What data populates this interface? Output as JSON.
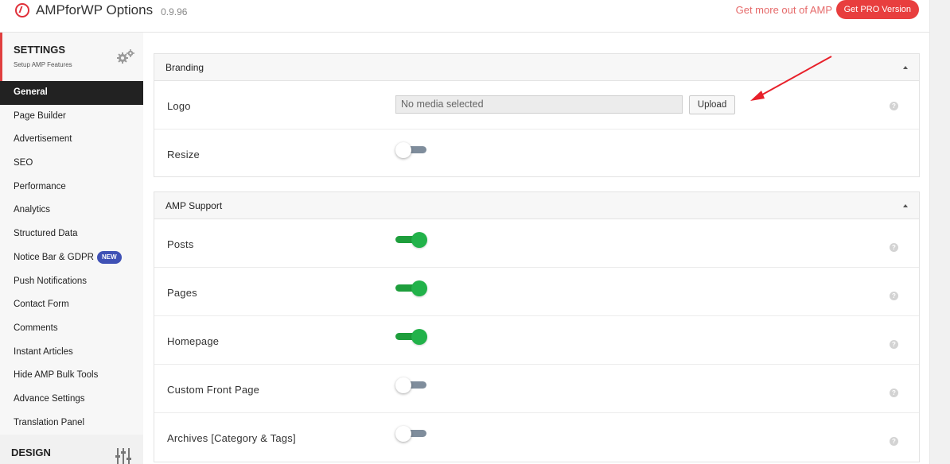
{
  "header": {
    "title": "AMPforWP Options",
    "version": "0.9.96",
    "more_link": "Get more out of AMP",
    "pro_button": "Get PRO Version"
  },
  "sidebar": {
    "settings_title": "SETTINGS",
    "settings_subtitle": "Setup AMP Features",
    "items": [
      {
        "label": "General",
        "active": true
      },
      {
        "label": "Page Builder"
      },
      {
        "label": "Advertisement"
      },
      {
        "label": "SEO"
      },
      {
        "label": "Performance"
      },
      {
        "label": "Analytics"
      },
      {
        "label": "Structured Data"
      },
      {
        "label": "Notice Bar & GDPR",
        "badge": "NEW"
      },
      {
        "label": "Push Notifications"
      },
      {
        "label": "Contact Form"
      },
      {
        "label": "Comments"
      },
      {
        "label": "Instant Articles"
      },
      {
        "label": "Hide AMP Bulk Tools"
      },
      {
        "label": "Advance Settings"
      },
      {
        "label": "Translation Panel"
      }
    ],
    "design_title": "DESIGN"
  },
  "branding": {
    "title": "Branding",
    "logo_label": "Logo",
    "media_placeholder": "No media selected",
    "upload_label": "Upload",
    "resize_label": "Resize",
    "resize_on": false
  },
  "amp_support": {
    "title": "AMP Support",
    "rows": [
      {
        "label": "Posts",
        "on": true
      },
      {
        "label": "Pages",
        "on": true
      },
      {
        "label": "Homepage",
        "on": true
      },
      {
        "label": "Custom Front Page",
        "on": false
      },
      {
        "label": "Archives [Category & Tags]",
        "on": false
      }
    ]
  },
  "colors": {
    "accent": "#e83e3e",
    "toggle_on": "#22b24a",
    "toggle_off": "#7f8d9c",
    "badge": "#3f51b5",
    "annotation_arrow": "#e8202a"
  }
}
